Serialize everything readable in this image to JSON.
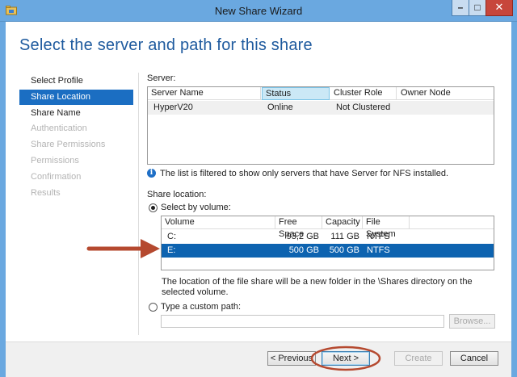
{
  "window": {
    "title": "New Share Wizard",
    "icon": "folder-share-icon",
    "controls": {
      "minimize": "–",
      "maximize": "□",
      "close": "✕"
    }
  },
  "page_title": "Select the server and path for this share",
  "nav": [
    {
      "label": "Select Profile",
      "state": "normal"
    },
    {
      "label": "Share Location",
      "state": "active"
    },
    {
      "label": "Share Name",
      "state": "normal"
    },
    {
      "label": "Authentication",
      "state": "disabled"
    },
    {
      "label": "Share Permissions",
      "state": "disabled"
    },
    {
      "label": "Permissions",
      "state": "disabled"
    },
    {
      "label": "Confirmation",
      "state": "disabled"
    },
    {
      "label": "Results",
      "state": "disabled"
    }
  ],
  "server": {
    "label": "Server:",
    "columns": [
      "Server Name",
      "Status",
      "Cluster Role",
      "Owner Node"
    ],
    "sorted_column": "Status",
    "rows": [
      {
        "name": "HyperV20",
        "status": "Online",
        "cluster_role": "Not Clustered",
        "owner_node": ""
      }
    ],
    "info": "The list is filtered to show only servers that have Server for NFS installed."
  },
  "share_location": {
    "label": "Share location:",
    "select_by_volume": "Select by volume:",
    "volume_columns": [
      "Volume",
      "Free Space",
      "Capacity",
      "File System"
    ],
    "volumes": [
      {
        "volume": "C:",
        "free_space": "93,2 GB",
        "capacity": "111 GB",
        "file_system": "NTFS",
        "selected": false
      },
      {
        "volume": "E:",
        "free_space": "500 GB",
        "capacity": "500 GB",
        "file_system": "NTFS",
        "selected": true
      }
    ],
    "note": "The location of the file share will be a new folder in the \\Shares directory on the selected volume.",
    "custom_path_label": "Type a custom path:",
    "custom_path_value": "",
    "browse_label": "Browse..."
  },
  "buttons": {
    "previous": "< Previous",
    "next": "Next >",
    "create": "Create",
    "cancel": "Cancel"
  },
  "annotation_colors": {
    "arrow": "#b5492f",
    "highlight_ellipse": "#b5492f"
  }
}
